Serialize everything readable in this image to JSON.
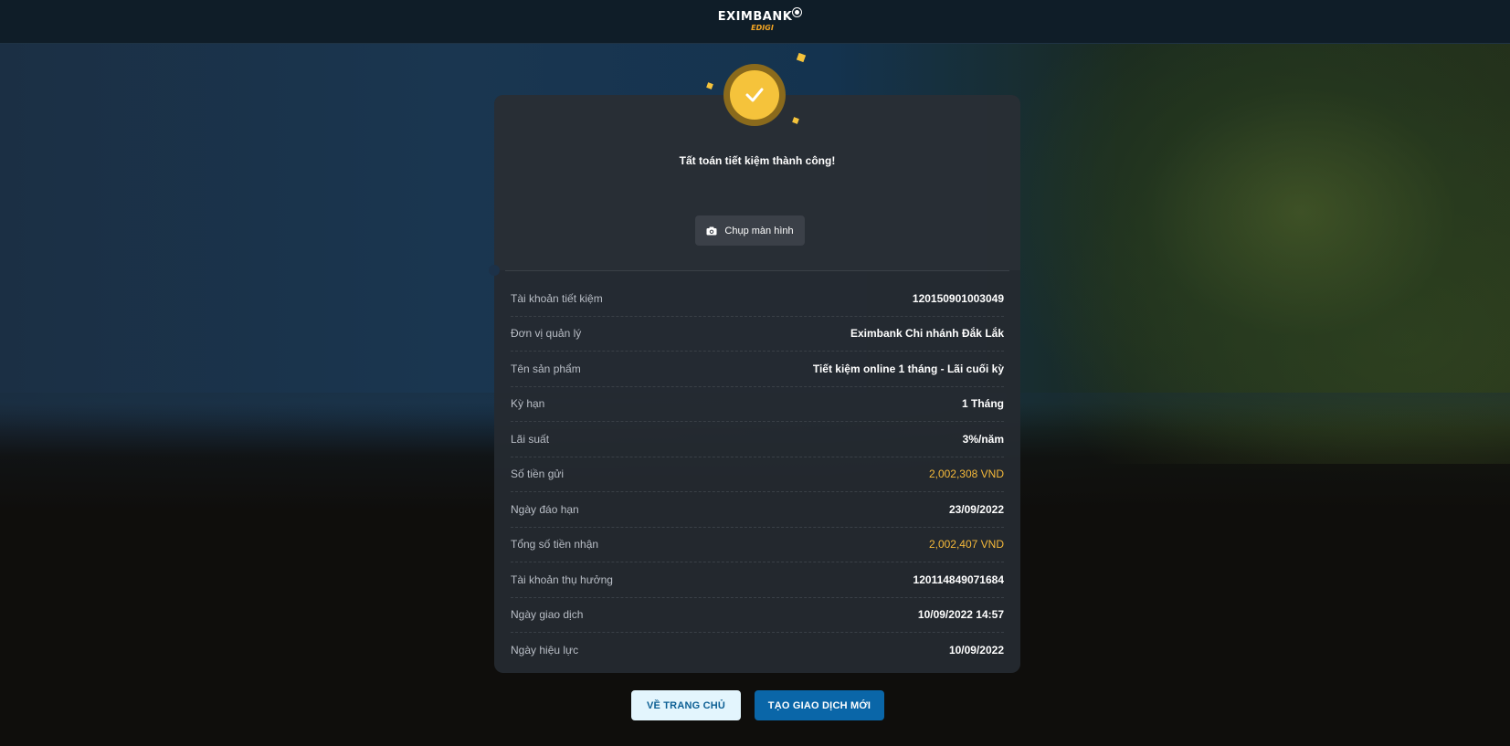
{
  "header": {
    "logo_main": "EXIMBANK",
    "logo_sub": "EDIGI"
  },
  "result": {
    "title": "Tất toán tiết kiệm thành công!",
    "screenshot_label": "Chụp màn hình"
  },
  "details": [
    {
      "label": "Tài khoản tiết kiệm",
      "value": "120150901003049"
    },
    {
      "label": "Đơn vị quản lý",
      "value": "Eximbank Chi nhánh Đắk Lắk"
    },
    {
      "label": "Tên sản phẩm",
      "value": "Tiết kiệm online 1 tháng - Lãi cuối kỳ"
    },
    {
      "label": "Kỳ hạn",
      "value": "1 Tháng"
    },
    {
      "label": "Lãi suất",
      "value": "3%/năm"
    },
    {
      "label": "Số tiền gửi",
      "value": "2,002,308 VND"
    },
    {
      "label": "Ngày đáo hạn",
      "value": "23/09/2022"
    },
    {
      "label": "Tổng số tiền nhận",
      "value": "2,002,407 VND"
    },
    {
      "label": "Tài khoản thụ hưởng",
      "value": "120114849071684"
    },
    {
      "label": "Ngày giao dịch",
      "value": "10/09/2022 14:57"
    },
    {
      "label": "Ngày hiệu lực",
      "value": "10/09/2022"
    }
  ],
  "actions": {
    "home_label": "VỀ TRANG CHỦ",
    "new_label": "TẠO GIAO DỊCH MỚI"
  },
  "colors": {
    "accent_amount": "#f5b93a",
    "check_circle": "#f5c33b",
    "primary_button": "#0a66a8"
  },
  "icons": {
    "success": "check-icon",
    "screenshot": "camera-icon"
  }
}
